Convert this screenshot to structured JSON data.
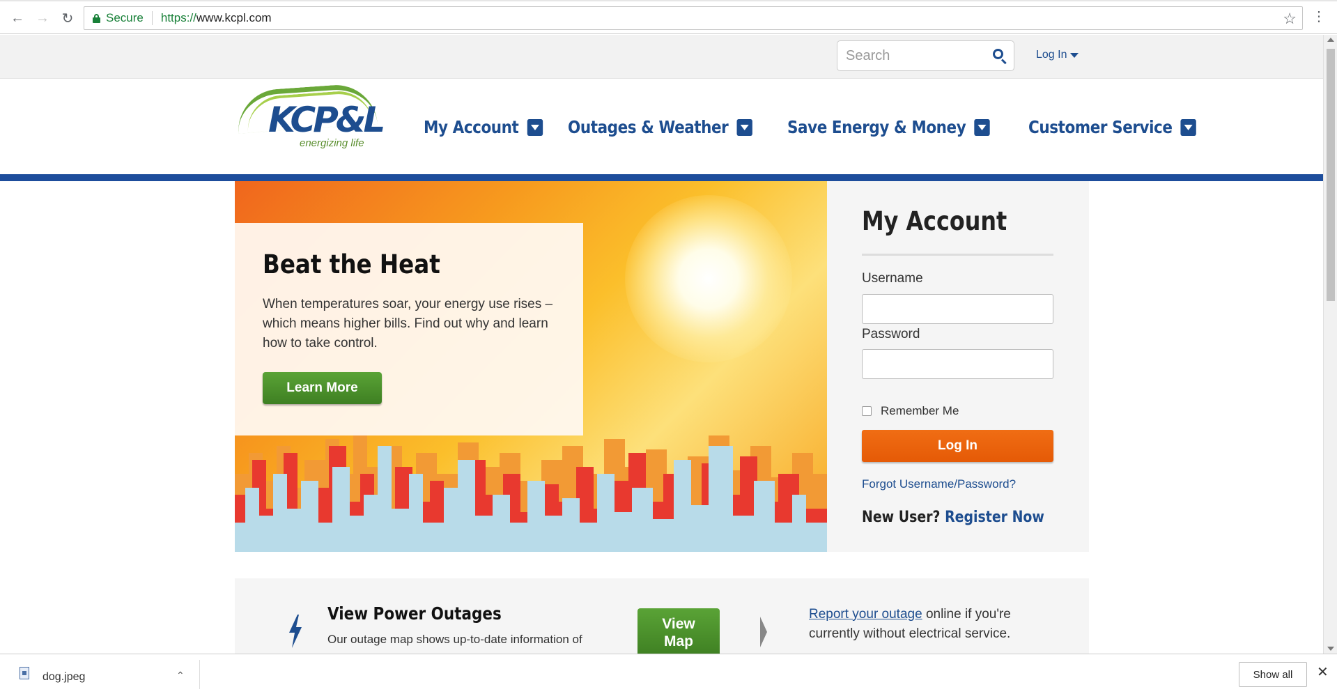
{
  "browser": {
    "secure_label": "Secure",
    "url_scheme": "https://",
    "url_host": "www.kcpl.com"
  },
  "utility": {
    "search_placeholder": "Search",
    "login_label": "Log In"
  },
  "logo": {
    "wordmark": "KCP&L",
    "tagline": "energizing life"
  },
  "nav": {
    "items": [
      {
        "label": "My Account"
      },
      {
        "label": "Outages & Weather"
      },
      {
        "label": "Save Energy & Money"
      },
      {
        "label": "Customer Service"
      }
    ]
  },
  "hero": {
    "title": "Beat the Heat",
    "body": "When temperatures soar, your energy use rises – which means higher bills. Find out why and learn how to take control.",
    "cta": "Learn More"
  },
  "account_panel": {
    "title": "My Account",
    "username_label": "Username",
    "username_value": "",
    "password_label": "Password",
    "password_value": "",
    "remember_label": "Remember Me",
    "login_button": "Log In",
    "forgot_link": "Forgot Username/Password?",
    "new_user_label": "New User?",
    "register_link": "Register Now"
  },
  "outages": {
    "title": "View Power Outages",
    "description": "Our outage map shows up-to-date information of",
    "view_map_button": "View Map",
    "report_link": "Report your outage",
    "report_text": " online if you're currently without electrical service."
  },
  "downloads": {
    "file_name": "dog.jpeg",
    "show_all": "Show all"
  },
  "colors": {
    "brand_blue": "#1d4d8f",
    "brand_green": "#4a9a2c",
    "cta_orange": "#ee6a10"
  }
}
